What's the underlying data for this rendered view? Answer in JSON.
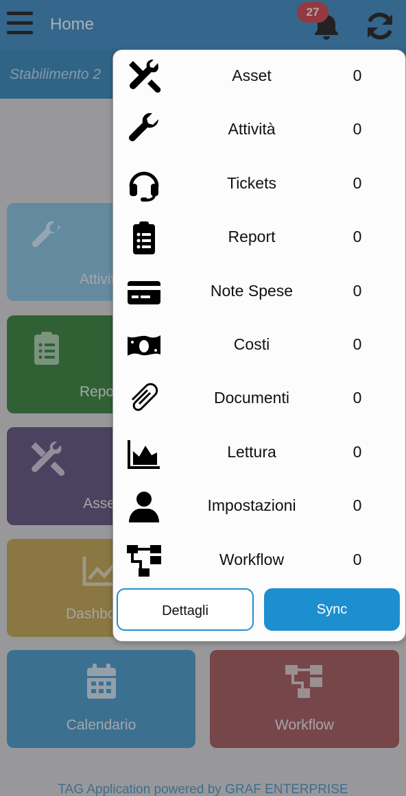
{
  "header": {
    "title": "Home",
    "notification_count": "27",
    "site": "Stabilimento 2"
  },
  "tiles": [
    {
      "label": "Attività",
      "color": "#6ba9c8"
    },
    {
      "label": "Report",
      "color": "#17661c"
    },
    {
      "label": "Asset",
      "color": "#43345f"
    },
    {
      "label": "Dashboard",
      "color": "#a98a2f"
    },
    {
      "label": "Calendario",
      "color": "#2a7fb0"
    },
    {
      "label": "Workflow",
      "color": "#8a3a3c"
    }
  ],
  "footer": "TAG Application powered by GRAF ENTERPRISE",
  "sync_menu": {
    "items": [
      {
        "label": "Asset",
        "count": "0",
        "icon": "tools-icon"
      },
      {
        "label": "Attività",
        "count": "0",
        "icon": "wrench-icon"
      },
      {
        "label": "Tickets",
        "count": "0",
        "icon": "headset-icon"
      },
      {
        "label": "Report",
        "count": "0",
        "icon": "clipboard-list-icon"
      },
      {
        "label": "Note Spese",
        "count": "0",
        "icon": "credit-card-icon"
      },
      {
        "label": "Costi",
        "count": "0",
        "icon": "money-bill-icon"
      },
      {
        "label": "Documenti",
        "count": "0",
        "icon": "paperclip-icon"
      },
      {
        "label": "Lettura",
        "count": "0",
        "icon": "area-chart-icon"
      },
      {
        "label": "Impostazioni",
        "count": "0",
        "icon": "user-icon"
      },
      {
        "label": "Workflow",
        "count": "0",
        "icon": "sitemap-icon"
      }
    ],
    "details_button": "Dettagli",
    "sync_button": "Sync"
  }
}
